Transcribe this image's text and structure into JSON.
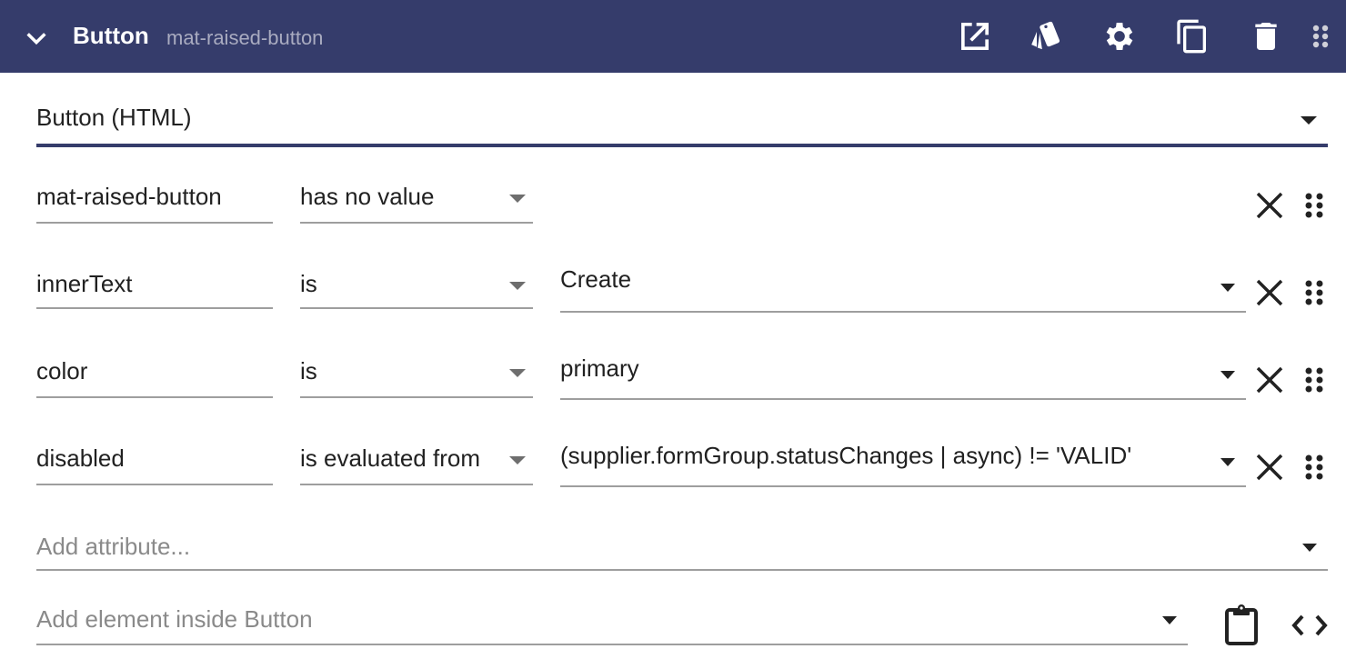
{
  "header": {
    "title": "Button",
    "subtitle": "mat-raised-button",
    "background": "#353c6b",
    "icons": [
      "open-in-new-icon",
      "style-icon",
      "settings-icon",
      "copy-icon",
      "delete-icon",
      "drag-handle-icon"
    ]
  },
  "element_type": {
    "value": "Button (HTML)",
    "accent": "#353c6b"
  },
  "attributes": [
    {
      "name": "mat-raised-button",
      "operator": "has no value",
      "value": null
    },
    {
      "name": "innerText",
      "operator": "is",
      "value": "Create"
    },
    {
      "name": "color",
      "operator": "is",
      "value": "primary"
    },
    {
      "name": "disabled",
      "operator": "is evaluated from",
      "value": "(supplier.formGroup.statusChanges | async) != 'VALID'"
    }
  ],
  "add_attribute": {
    "placeholder": "Add attribute..."
  },
  "add_element": {
    "placeholder": "Add element inside Button"
  }
}
